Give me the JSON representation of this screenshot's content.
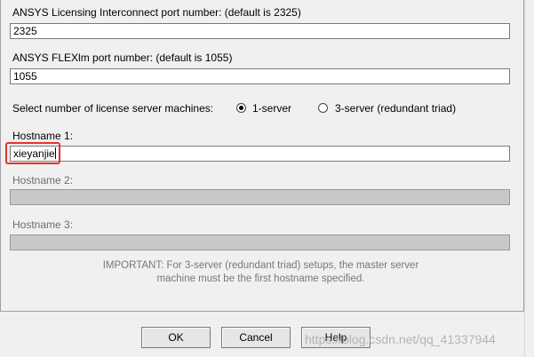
{
  "interconnect": {
    "label": "ANSYS Licensing Interconnect port number: (default is 2325)",
    "value": "2325"
  },
  "flexlm": {
    "label": "ANSYS FLEXlm port number: (default is 1055)",
    "value": "1055"
  },
  "server_count": {
    "label": "Select number of license server machines:",
    "options": [
      {
        "label": "1-server",
        "selected": true
      },
      {
        "label": "3-server (redundant triad)",
        "selected": false
      }
    ]
  },
  "hostname1": {
    "label": "Hostname 1:",
    "value": "xieyanjie"
  },
  "hostname2": {
    "label": "Hostname 2:",
    "value": ""
  },
  "hostname3": {
    "label": "Hostname 3:",
    "value": ""
  },
  "note": "IMPORTANT: For 3-server (redundant triad) setups, the master server machine must be the first hostname specified.",
  "buttons": {
    "ok": "OK",
    "cancel": "Cancel",
    "help": "Help"
  },
  "watermark": "https://blog.csdn.net/qq_41337944",
  "colors": {
    "highlight": "#e5332a"
  }
}
